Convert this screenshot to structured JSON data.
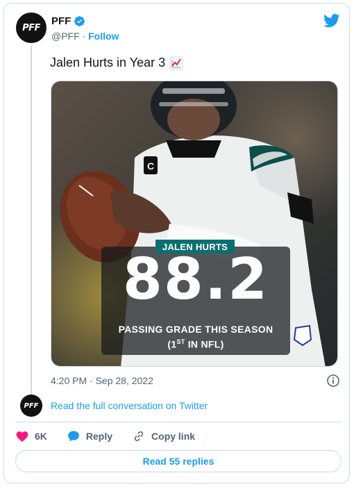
{
  "account": {
    "name": "PFF",
    "handle": "@PFF",
    "separator": "·",
    "follow_label": "Follow",
    "avatar_text": "PFF"
  },
  "tweet": {
    "text": "Jalen Hurts in Year 3",
    "emoji": "chart-increasing-icon",
    "timestamp": "4:20 PM · Sep 28, 2022"
  },
  "media": {
    "player_label": "JALEN HURTS",
    "grade": "88.2",
    "caption_line1": "PASSING GRADE THIS SEASON",
    "caption_line2_prefix": "(1",
    "caption_line2_sup": "ST",
    "caption_line2_suffix": " IN NFL)"
  },
  "conversation": {
    "avatar_text": "PFF",
    "link_text": "Read the full conversation on Twitter"
  },
  "actions": {
    "likes": "6K",
    "reply_label": "Reply",
    "copy_label": "Copy link"
  },
  "replies_button": "Read 55 replies",
  "colors": {
    "accent": "#1d9bf0",
    "like": "#f91880",
    "teal": "#0b6f6f"
  }
}
